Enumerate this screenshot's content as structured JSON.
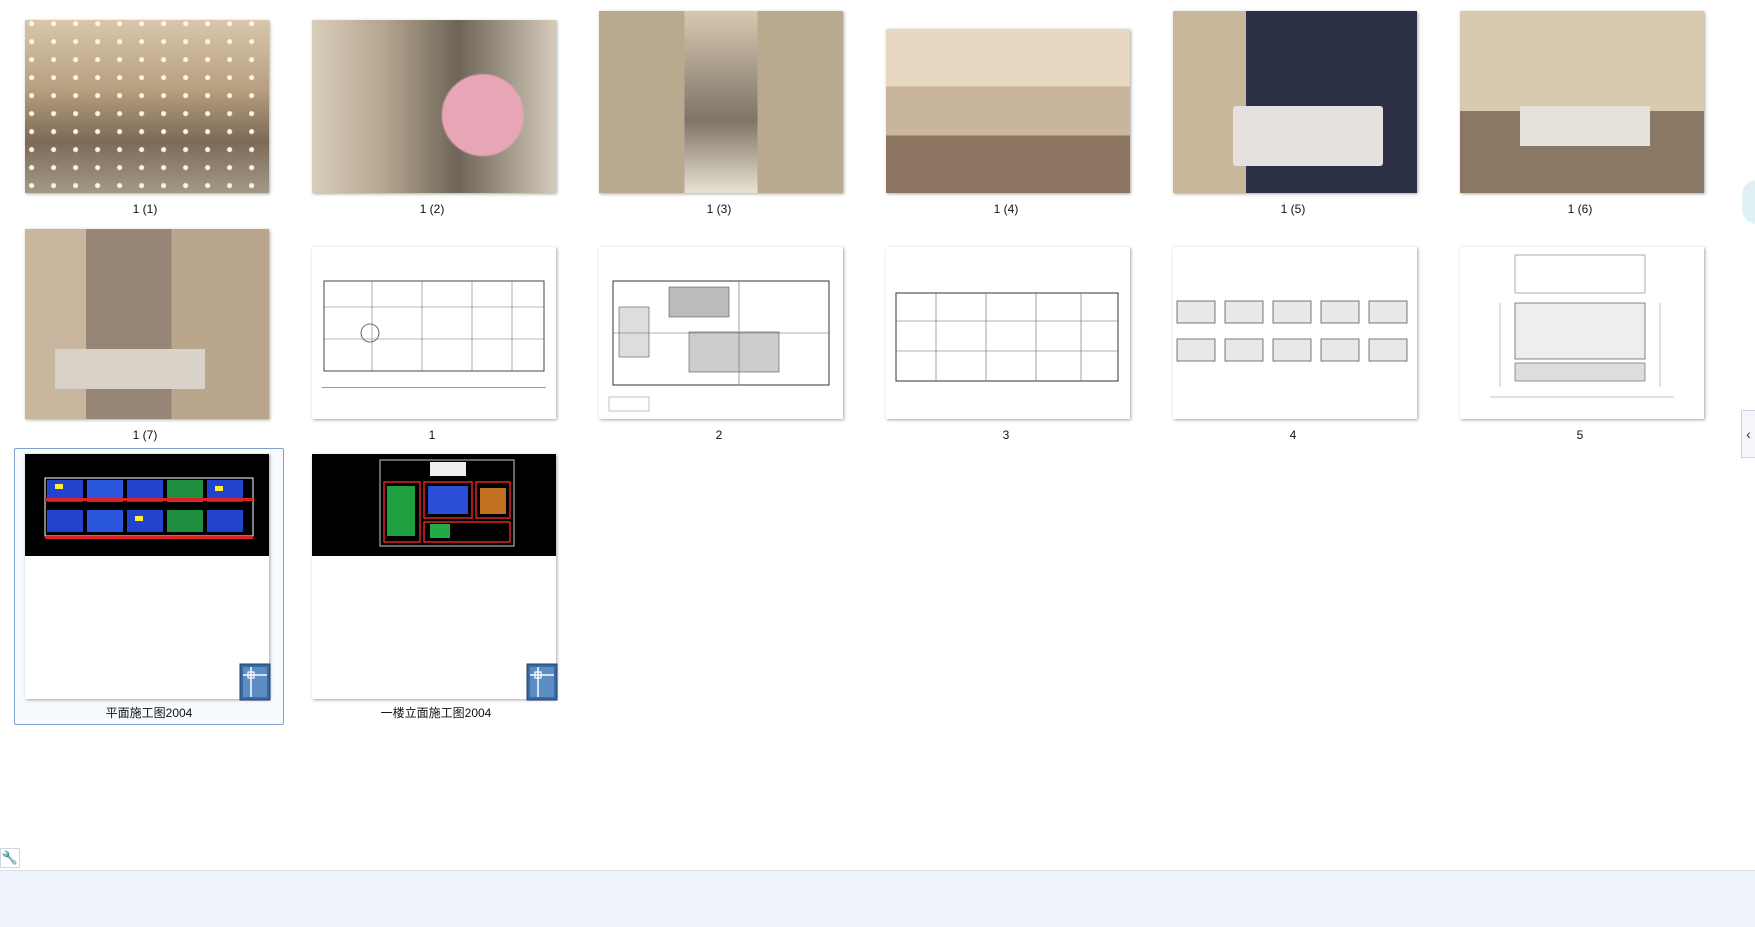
{
  "files": [
    {
      "label": "1 (1)"
    },
    {
      "label": "1 (2)"
    },
    {
      "label": "1 (3)"
    },
    {
      "label": "1 (4)"
    },
    {
      "label": "1 (5)"
    },
    {
      "label": "1 (6)"
    },
    {
      "label": "1 (7)"
    },
    {
      "label": "1"
    },
    {
      "label": "2"
    },
    {
      "label": "3"
    },
    {
      "label": "4"
    },
    {
      "label": "5"
    },
    {
      "label": "平面施工图2004"
    },
    {
      "label": "一楼立面施工图2004"
    }
  ],
  "icons": {
    "settings": "wrench-icon",
    "panel_toggle": "chevron-left-icon",
    "file_type": "dwg-file-icon"
  },
  "colors": {
    "selection_border": "#7da2ce",
    "statusbar_bg": "#eef2fa"
  }
}
